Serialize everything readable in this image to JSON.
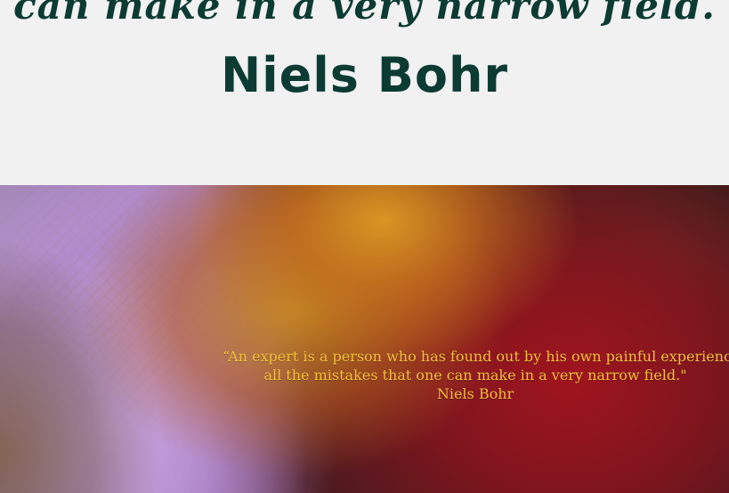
{
  "header": {
    "quote_fragment": "can make in a very narrow field.",
    "author": "Niels Bohr"
  },
  "image": {
    "overlay": {
      "line1": "“An expert is a person who has found out by his own painful experience",
      "line2": "all the mistakes that one can make in a very narrow field.\"",
      "author": "Niels Bohr",
      "text_color": "#f2bf3b"
    }
  },
  "colors": {
    "page_background": "#f1f1f1",
    "heading_text": "#0c3b33"
  }
}
